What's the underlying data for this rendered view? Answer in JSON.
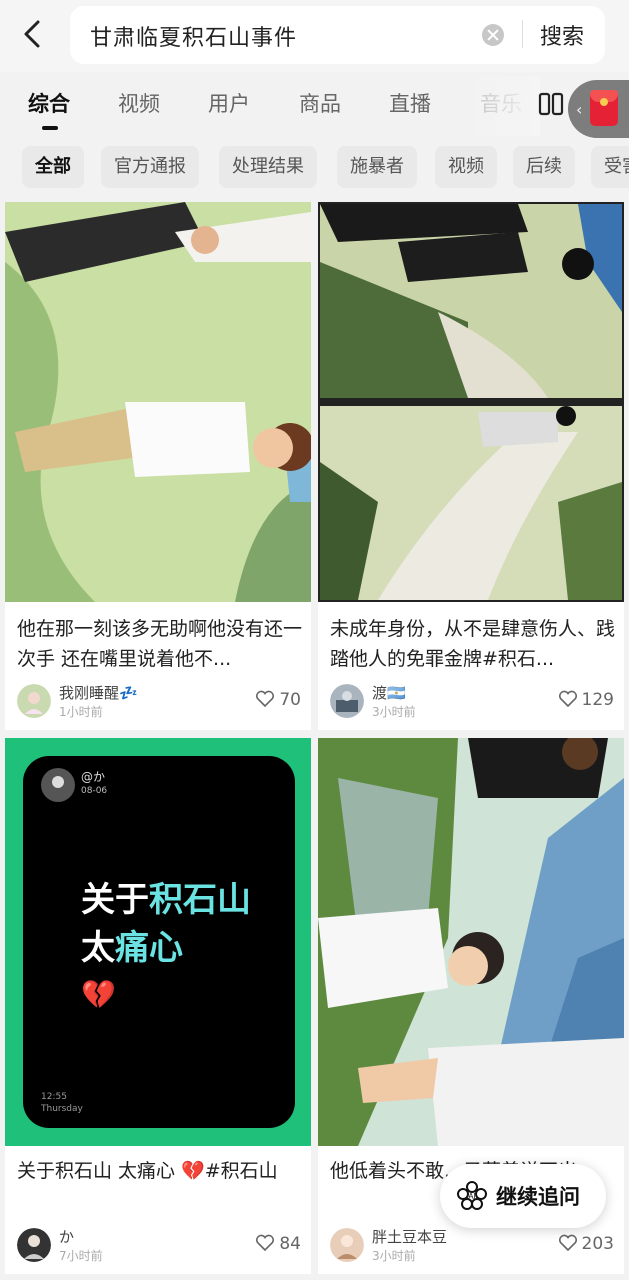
{
  "search": {
    "query": "甘肃临夏积石山事件",
    "button_label": "搜索"
  },
  "tabs": [
    {
      "label": "综合",
      "active": true
    },
    {
      "label": "视频"
    },
    {
      "label": "用户"
    },
    {
      "label": "商品"
    },
    {
      "label": "直播"
    },
    {
      "label": "音乐"
    }
  ],
  "chips": [
    {
      "label": "全部",
      "active": true
    },
    {
      "label": "官方通报"
    },
    {
      "label": "处理结果"
    },
    {
      "label": "施暴者"
    },
    {
      "label": "视频"
    },
    {
      "label": "后续"
    },
    {
      "label": "受害"
    }
  ],
  "cards": [
    {
      "title": "他在那一刻该多无助啊他没有还一次手 还在嘴里说着他不...",
      "author": "我刚睡醒💤",
      "time": "1小时前",
      "likes": "70"
    },
    {
      "title": "未成年身份，从不是肆意伤人、践踏他人的免罪金牌#积石...",
      "author": "渡🇦🇷",
      "time": "3小时前",
      "likes": "129"
    },
    {
      "title": "关于积石山 太痛心 💔#积石山",
      "author": "か",
      "time": "7小时前",
      "likes": "84",
      "thumb": {
        "handle": "@か",
        "date": "08-06",
        "line1a": "关于",
        "line1b": "积石山",
        "line2a": "太",
        "line2b": "痛心",
        "emoji": "💔",
        "clock": "12:55",
        "day": "Thursday"
      }
    },
    {
      "title": "他低着头不敢…子藏着说不出…",
      "author": "胖土豆本豆",
      "time": "3小时前",
      "likes": "203"
    }
  ],
  "followup": {
    "label": "继续追问",
    "icon": "ai-flower-icon"
  },
  "colors": {
    "accent_green": "#1fc07a",
    "cyan_text": "#6be3e3",
    "red_packet": "#e5172b"
  }
}
